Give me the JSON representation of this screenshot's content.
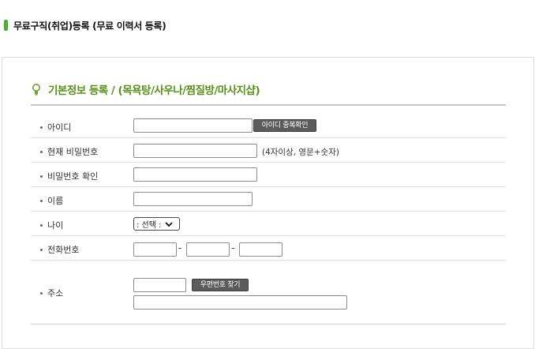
{
  "header": {
    "title": "무료구직(취업)등록 (무료 이력서 등록)",
    "accent": "#4caf2c"
  },
  "section": {
    "title": "기본정보 등록 / (목욕탕/사우나/찜질방/마사지샵)",
    "title_color": "#5a8f1e",
    "icon": "lightbulb-icon"
  },
  "form": {
    "userid": {
      "label": "아이디",
      "value": "",
      "check_button": "아이디 중복확인"
    },
    "password": {
      "label": "현재 비밀번호",
      "value": "",
      "hint": "(4자이상, 영문+숫자)"
    },
    "password_confirm": {
      "label": "비밀번호 확인",
      "value": ""
    },
    "name": {
      "label": "이름",
      "value": ""
    },
    "age": {
      "label": "나이",
      "selected": ": 선택 :"
    },
    "phone": {
      "label": "전화번호",
      "part1": "",
      "part2": "",
      "part3": "",
      "separator": "-"
    },
    "address": {
      "label": "주소",
      "postcode": "",
      "postcode_button": "우편번호 찾기",
      "detail": ""
    }
  }
}
